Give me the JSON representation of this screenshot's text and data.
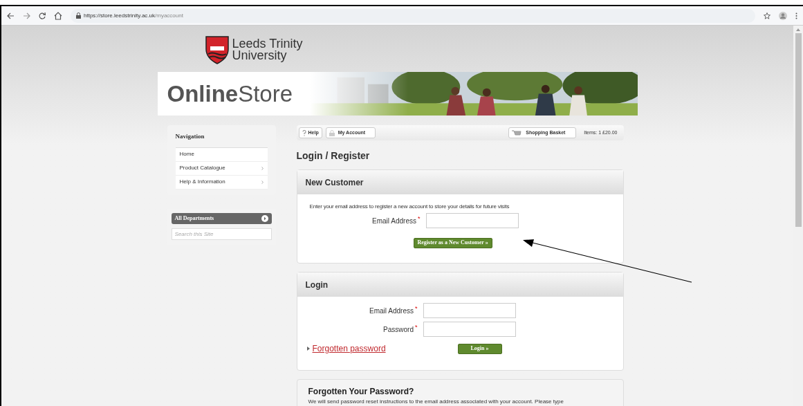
{
  "browser": {
    "url_host": "https://store.leedstrinity.ac.uk",
    "url_path": "/myaccount"
  },
  "logo": {
    "line1": "Leeds Trinity",
    "line2": "University"
  },
  "banner": {
    "title_bold": "Online",
    "title_light": "Store",
    "kind": "picture"
  },
  "navigation": {
    "title": "Navigation",
    "items": [
      {
        "label": "Home",
        "has_submenu": false
      },
      {
        "label": "Product Catalogue",
        "has_submenu": true
      },
      {
        "label": "Help & Information",
        "has_submenu": true
      }
    ]
  },
  "departments": {
    "label": "All Departments",
    "search_placeholder": "Search this Site"
  },
  "toolbar": {
    "help": "Help",
    "account": "My Account",
    "basket": "Shopping Basket",
    "items": "Items: 1 £20.00"
  },
  "page_title": "Login / Register",
  "new_customer": {
    "title": "New Customer",
    "intro": "Enter your email address to register a new account to store your details for future visits",
    "fields": [
      {
        "label": "Email Address",
        "mark": "*"
      }
    ],
    "button": "Register as a New Customer »"
  },
  "login": {
    "title": "Login",
    "fields": [
      {
        "label": "Email Address",
        "mark": "*"
      },
      {
        "label": "Password",
        "mark": "*"
      }
    ],
    "forgot_link": "Forgotten password",
    "button": "Login »"
  },
  "forgotten": {
    "title": "Forgotten Your Password?",
    "text": "We will send password reset instructions to the email address associated with your account. Please type"
  }
}
